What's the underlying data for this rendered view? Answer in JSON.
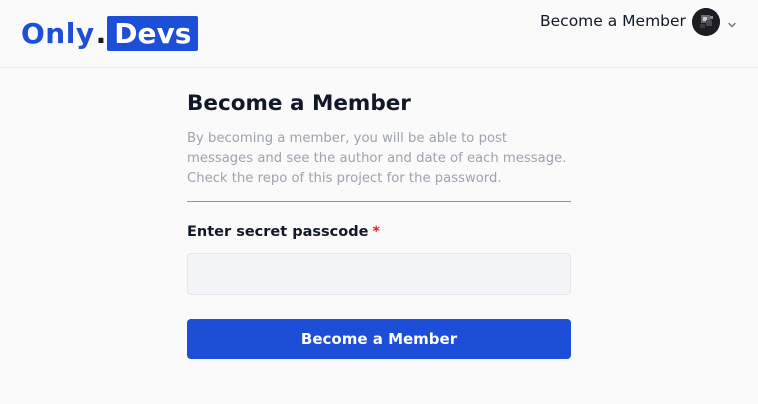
{
  "brand": {
    "part1": "Only",
    "dot": ".",
    "part2": "Devs"
  },
  "nav": {
    "member_link": "Become a Member",
    "avatar_icon": "user-avatar-icon",
    "menu_icon": "chevron-down-icon"
  },
  "form": {
    "title": "Become a Member",
    "description": "By becoming a member, you will be able to post messages and see the author and date of each message. Check the repo of this project for the password.",
    "label": "Enter secret passcode",
    "required_mark": "*",
    "input_value": "",
    "submit_label": "Become a Member"
  },
  "colors": {
    "accent": "#1d4ed8",
    "required": "#dc2626",
    "muted_text": "#9ca3af"
  }
}
